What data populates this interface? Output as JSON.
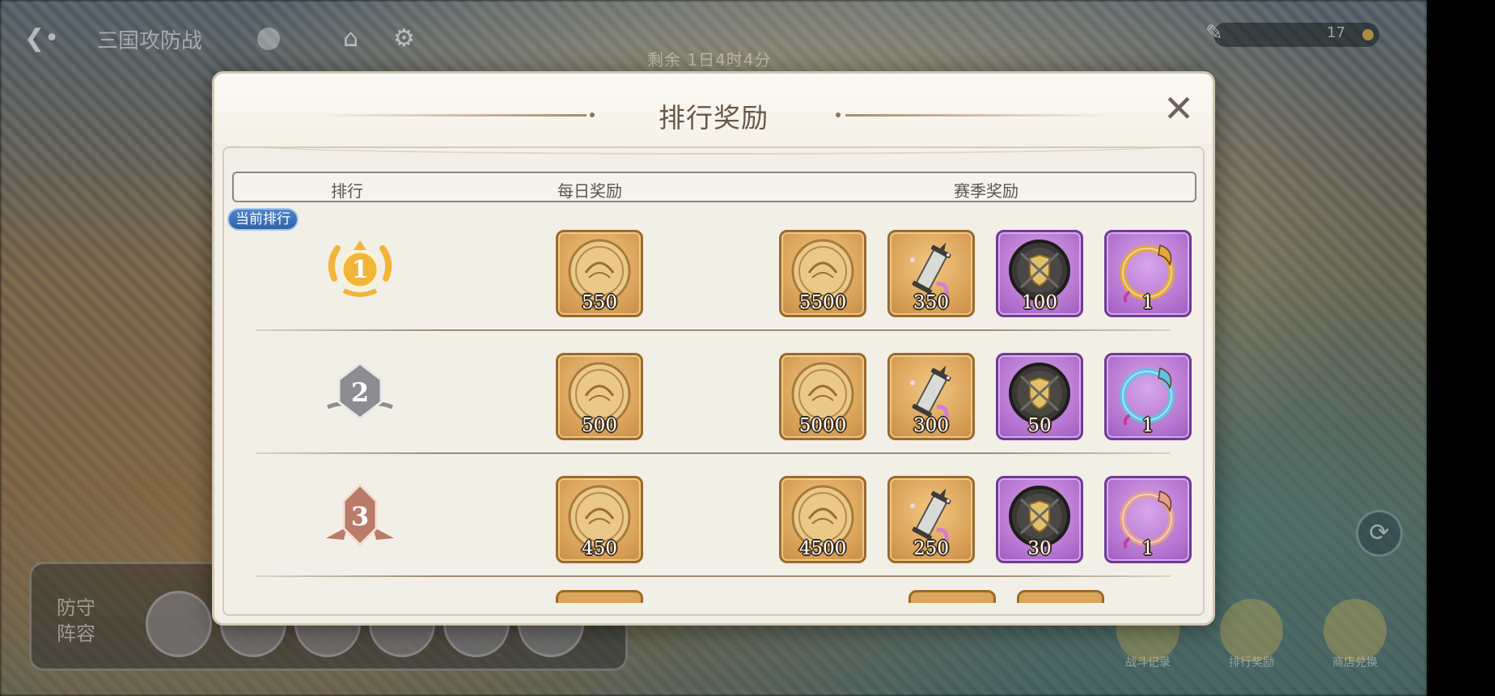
{
  "topbar": {
    "back_icon": "back-arrow-icon",
    "title": "三国攻防战",
    "season_timer": "剩余 1日4时4分",
    "currency_value": "17"
  },
  "modal": {
    "title": "排行奖励",
    "close_label": "✕",
    "columns": {
      "rank": "排行",
      "daily": "每日奖励",
      "season": "赛季奖励"
    },
    "current_rank_tag": "当前排行",
    "rows": [
      {
        "rank": "1",
        "rank_color": "#f2b53a",
        "daily": [
          {
            "icon": "coin-icon",
            "count": "550",
            "frame": "gold"
          }
        ],
        "season": [
          {
            "icon": "coin-icon",
            "count": "5500",
            "frame": "gold"
          },
          {
            "icon": "scroll-icon",
            "count": "350",
            "frame": "gold"
          },
          {
            "icon": "shield-badge-icon",
            "count": "100",
            "frame": "purple"
          },
          {
            "icon": "dragon-ring-icon",
            "count": "1",
            "frame": "purple",
            "ring_color": "#e3a93a"
          }
        ]
      },
      {
        "rank": "2",
        "rank_color": "#8d8d91",
        "daily": [
          {
            "icon": "coin-icon",
            "count": "500",
            "frame": "gold"
          }
        ],
        "season": [
          {
            "icon": "coin-icon",
            "count": "5000",
            "frame": "gold"
          },
          {
            "icon": "scroll-icon",
            "count": "300",
            "frame": "gold"
          },
          {
            "icon": "shield-badge-icon",
            "count": "50",
            "frame": "purple"
          },
          {
            "icon": "dragon-ring-icon",
            "count": "1",
            "frame": "purple",
            "ring_color": "#5cc4e6"
          }
        ]
      },
      {
        "rank": "3",
        "rank_color": "#b97c6b",
        "daily": [
          {
            "icon": "coin-icon",
            "count": "450",
            "frame": "gold"
          }
        ],
        "season": [
          {
            "icon": "coin-icon",
            "count": "4500",
            "frame": "gold"
          },
          {
            "icon": "scroll-icon",
            "count": "250",
            "frame": "gold"
          },
          {
            "icon": "shield-badge-icon",
            "count": "30",
            "frame": "purple"
          },
          {
            "icon": "dragon-ring-icon",
            "count": "1",
            "frame": "purple",
            "ring_color": "#e6a08a"
          }
        ]
      }
    ]
  },
  "bottom": {
    "formation_label": "防守阵容",
    "buttons": [
      "战斗记录",
      "排行奖励",
      "商店兑换"
    ]
  }
}
